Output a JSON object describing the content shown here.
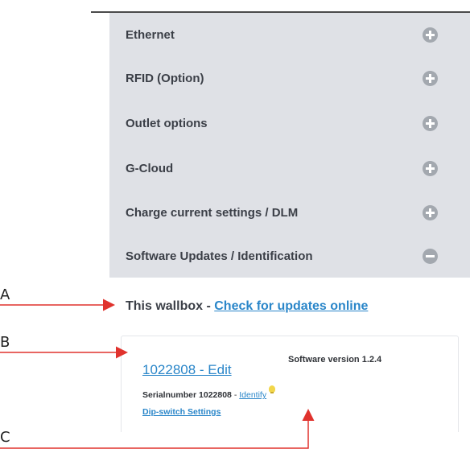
{
  "menu": {
    "items": [
      {
        "label": "Ethernet",
        "state": "collapsed"
      },
      {
        "label": "RFID (Option)",
        "state": "collapsed"
      },
      {
        "label": "Outlet options",
        "state": "collapsed"
      },
      {
        "label": "G-Cloud",
        "state": "collapsed"
      },
      {
        "label": "Charge current settings / DLM",
        "state": "collapsed"
      },
      {
        "label": "Software Updates / Identification",
        "state": "expanded"
      }
    ]
  },
  "section": {
    "title_prefix": "This wallbox - ",
    "check_link": "Check for updates online"
  },
  "device": {
    "edit_link": "1022808 - Edit",
    "software_version": "Software version 1.2.4",
    "serial_label": "Serialnumber 1022808",
    "serial_separator": " - ",
    "identify_link": "Identify",
    "dip_link": "Dip-switch Settings"
  },
  "annotations": {
    "a": "A",
    "b": "B",
    "c": "C"
  },
  "colors": {
    "menu_bg": "#dfe1e6",
    "link": "#2a86c9",
    "arrow": "#e0322d",
    "icon": "#a3a8af"
  }
}
